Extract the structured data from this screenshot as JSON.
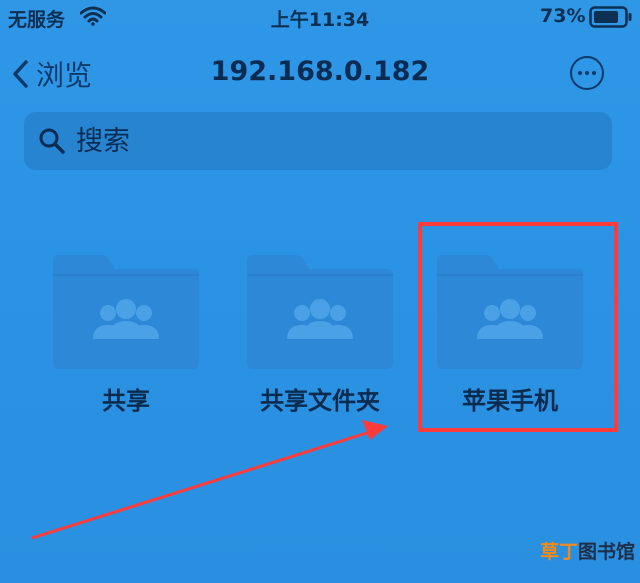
{
  "status_bar": {
    "carrier": "无服务",
    "time": "上午11:34",
    "battery_percent": "73%"
  },
  "nav": {
    "back_label": "浏览",
    "title": "192.168.0.182"
  },
  "search": {
    "placeholder": "搜索"
  },
  "folders": [
    {
      "label": "共享",
      "icon": "shared-folder-icon"
    },
    {
      "label": "共享文件夹",
      "icon": "shared-folder-icon"
    },
    {
      "label": "苹果手机",
      "icon": "shared-folder-icon",
      "highlighted": true
    }
  ],
  "annotation": {
    "highlight_color": "#ff3b3b",
    "arrow_color": "#ff3b3b"
  },
  "watermark": {
    "part1": "草丁",
    "part2": "图书馆"
  },
  "colors": {
    "background": "#2f97e6",
    "folder": "#2d88d8",
    "folder_tab": "#2a80cf"
  }
}
